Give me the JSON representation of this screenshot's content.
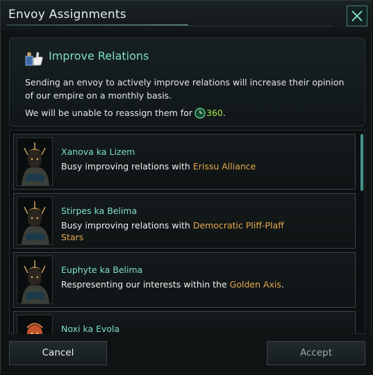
{
  "window": {
    "title": "Envoy Assignments"
  },
  "icons": {
    "close": "close-x-icon",
    "relations": "thumbs-up-envoy-icon",
    "time": "clock-icon"
  },
  "info": {
    "heading": "Improve Relations",
    "description": "Sending an envoy to actively improve relations will increase their opinion of our empire on a monthly basis.",
    "lock_prefix": "We will be unable to reassign them for",
    "lock_value": "360",
    "lock_suffix": "."
  },
  "envoys": [
    {
      "name": "Xanova ka Lizem",
      "status_prefix": "Busy improving relations with",
      "status_target": "Erissu Alliance",
      "status_suffix": ""
    },
    {
      "name": "Stirpes ka Belima",
      "status_prefix": "Busy improving relations with",
      "status_target": "Democratic Pliff-Plaff Stars",
      "status_suffix": ""
    },
    {
      "name": "Euphyte ka Belima",
      "status_prefix": "Respresenting our interests within the",
      "status_target": "Golden Axis",
      "status_suffix": "."
    },
    {
      "name": "Noxi ka Evola",
      "status_prefix": "",
      "status_target": "",
      "status_suffix": ""
    }
  ],
  "buttons": {
    "cancel": "Cancel",
    "accept": "Accept"
  },
  "colors": {
    "accent_green": "#7fe1c7",
    "highlight_orange": "#e6a94c",
    "time_green": "#a8e84a"
  }
}
